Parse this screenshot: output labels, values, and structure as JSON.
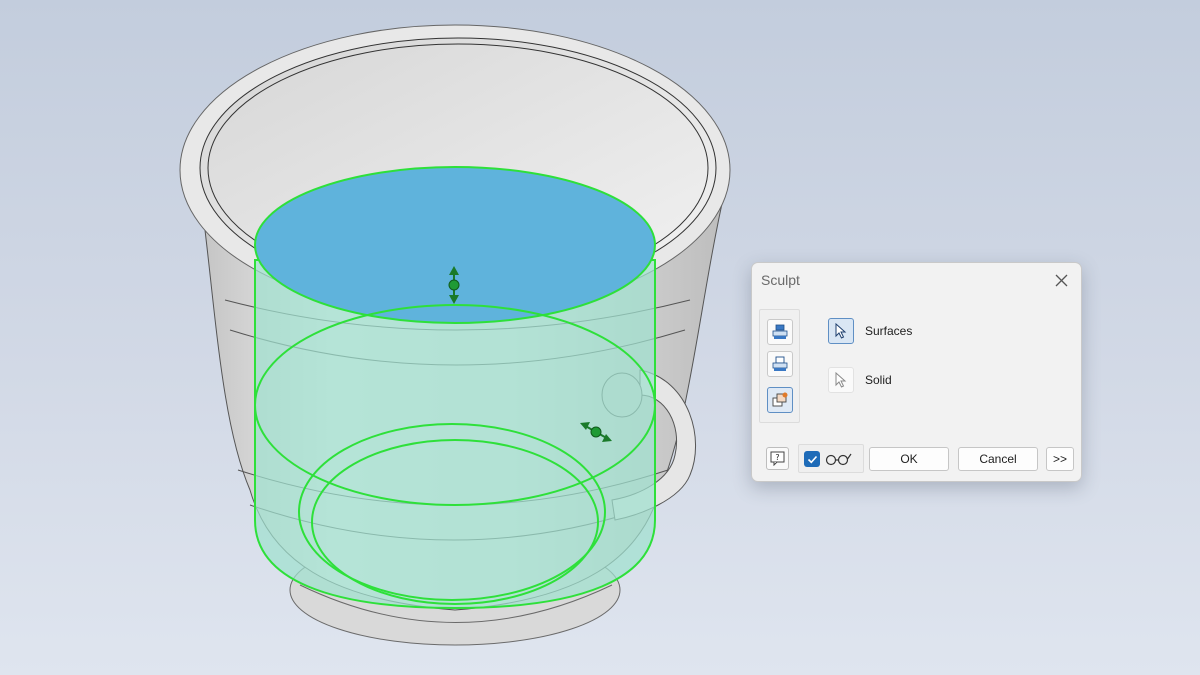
{
  "dialog": {
    "title": "Sculpt",
    "close_icon": "close-icon",
    "tools": [
      {
        "name": "add-mode",
        "icon": "add-solid-icon",
        "active": false
      },
      {
        "name": "remove-mode",
        "icon": "remove-solid-icon",
        "active": false
      },
      {
        "name": "new-solid-mode",
        "icon": "new-solid-icon",
        "active": true
      }
    ],
    "select": {
      "surfaces_label": "Surfaces",
      "solid_label": "Solid"
    },
    "help_icon": "help-icon",
    "preview_checked": true,
    "preview_icon": "glasses-icon",
    "ok_label": "OK",
    "cancel_label": "Cancel",
    "more_label": ">>"
  },
  "colors": {
    "selection_green": "#2ee03a",
    "surface_blue": "#5fb3dc",
    "surface_mint": "#9fe0cf",
    "accent_blue": "#1e6bb8"
  }
}
